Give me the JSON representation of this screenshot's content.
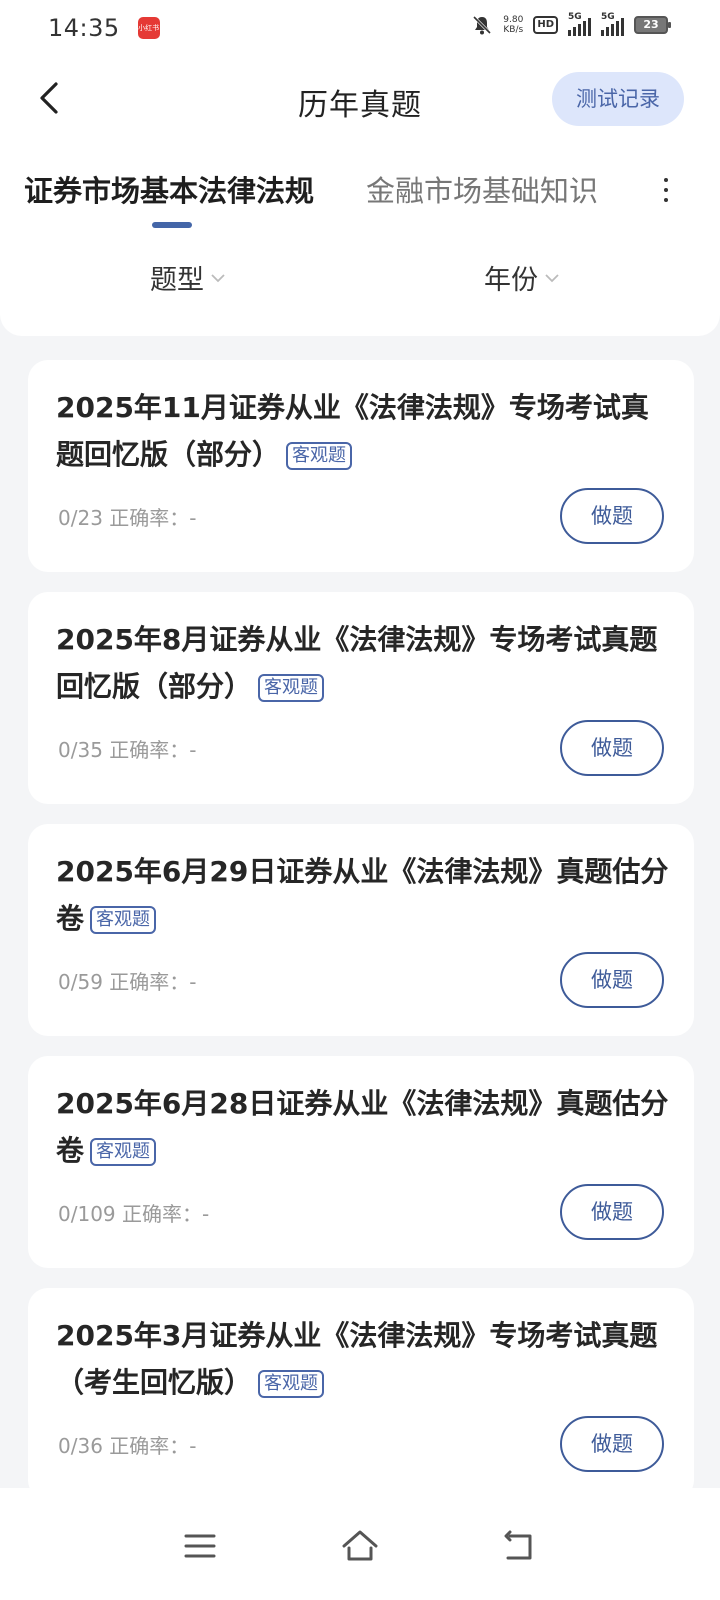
{
  "status": {
    "time": "14:35",
    "app_badge": "小红书",
    "net_speed_value": "9.80",
    "net_speed_unit": "KB/s",
    "hd_label": "HD",
    "sim1_label": "5G",
    "sim2_label": "5G",
    "battery": "23"
  },
  "header": {
    "title": "历年真题",
    "record_button": "测试记录"
  },
  "tabs": {
    "active": "证券市场基本法律法规",
    "inactive": "金融市场基础知识"
  },
  "filters": {
    "type": "题型",
    "year": "年份"
  },
  "cards": [
    {
      "title": "2025年11月证券从业《法律法规》专场考试真题回忆版（部分）",
      "tag": "客观题",
      "progress": "0/23 正确率：-",
      "button": "做题"
    },
    {
      "title": "2025年8月证券从业《法律法规》专场考试真题回忆版（部分）",
      "tag": "客观题",
      "progress": "0/35 正确率：-",
      "button": "做题"
    },
    {
      "title": "2025年6月29日证券从业《法律法规》真题估分卷",
      "tag": "客观题",
      "progress": "0/59 正确率：-",
      "button": "做题"
    },
    {
      "title": "2025年6月28日证券从业《法律法规》真题估分卷",
      "tag": "客观题",
      "progress": "0/109 正确率：-",
      "button": "做题"
    },
    {
      "title": "2025年3月证券从业《法律法规》专场考试真题（考生回忆版）",
      "tag": "客观题",
      "progress": "0/36 正确率：-",
      "button": "做题"
    }
  ],
  "icons": {
    "back": "chevron-left-icon",
    "more": "more-vertical-icon",
    "filter_chevron": "chevron-down-icon",
    "nav_menu": "menu-icon",
    "nav_home": "home-icon",
    "nav_back": "back-icon"
  },
  "colors": {
    "accent": "#4a66a8",
    "record_bg": "#dde6fb",
    "page_bg": "#f4f5f7",
    "card_bg": "#ffffff"
  }
}
